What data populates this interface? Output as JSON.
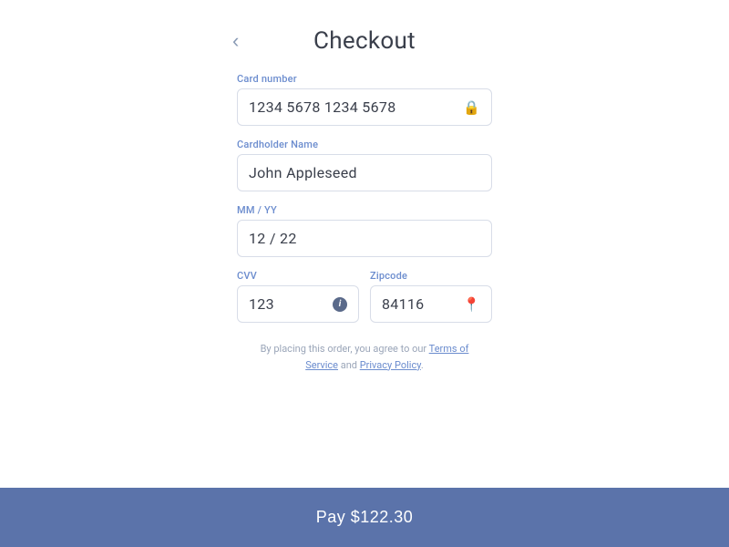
{
  "header": {
    "back_label": "‹",
    "title": "Checkout"
  },
  "form": {
    "card_number": {
      "label": "Card number",
      "value": "1234 5678 1234 5678",
      "icon": "lock"
    },
    "cardholder_name": {
      "label": "Cardholder Name",
      "value": "John Appleseed"
    },
    "expiry": {
      "label": "MM / YY",
      "value": "12 / 22"
    },
    "cvv": {
      "label": "CVV",
      "value": "123",
      "icon": "info"
    },
    "zipcode": {
      "label": "Zipcode",
      "value": "84116",
      "icon": "pin"
    }
  },
  "terms": {
    "prefix": "By placing this order, you agree to our ",
    "link1": "Terms of Service",
    "conjunction": " and ",
    "link2": "Privacy Policy",
    "suffix": "."
  },
  "pay_button": {
    "label": "Pay $122.30"
  }
}
